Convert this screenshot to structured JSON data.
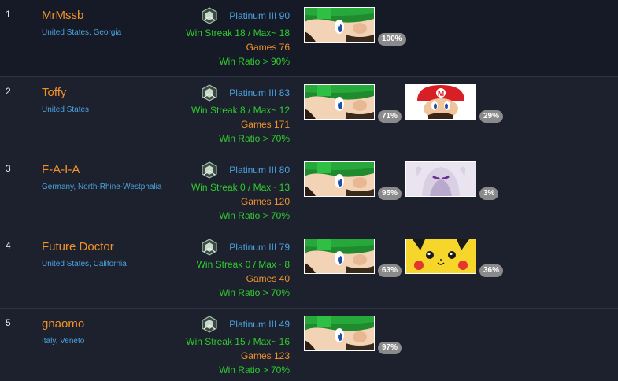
{
  "players": [
    {
      "rank": "1",
      "name": "MrMssb",
      "location": "United States, Georgia",
      "rank_label": "Platinum III 90",
      "win_streak": "Win Streak 18 / Max~ 18",
      "games": "Games 76",
      "win_ratio": "Win Ratio > 90%",
      "characters": [
        {
          "icon": "luigi-icon",
          "percent": "100%"
        }
      ]
    },
    {
      "rank": "2",
      "name": "Toffy",
      "location": "United States",
      "rank_label": "Platinum III 83",
      "win_streak": "Win Streak 8 / Max~ 12",
      "games": "Games 171",
      "win_ratio": "Win Ratio > 70%",
      "characters": [
        {
          "icon": "luigi-icon",
          "percent": "71%"
        },
        {
          "icon": "mario-icon",
          "percent": "29%"
        }
      ]
    },
    {
      "rank": "3",
      "name": "F-A-I-A",
      "location": "Germany, North-Rhine-Westphalia",
      "rank_label": "Platinum III 80",
      "win_streak": "Win Streak 0 / Max~ 13",
      "games": "Games 120",
      "win_ratio": "Win Ratio > 70%",
      "characters": [
        {
          "icon": "luigi-icon",
          "percent": "95%"
        },
        {
          "icon": "mewtwo-icon",
          "percent": "3%"
        }
      ]
    },
    {
      "rank": "4",
      "name": "Future Doctor",
      "location": "United States, California",
      "rank_label": "Platinum III 79",
      "win_streak": "Win Streak 0 / Max~ 8",
      "games": "Games 40",
      "win_ratio": "Win Ratio > 70%",
      "characters": [
        {
          "icon": "luigi-icon",
          "percent": "63%"
        },
        {
          "icon": "pikachu-icon",
          "percent": "36%"
        }
      ]
    },
    {
      "rank": "5",
      "name": "gnaomo",
      "location": "Italy, Veneto",
      "rank_label": "Platinum III 49",
      "win_streak": "Win Streak 15 / Max~ 16",
      "games": "Games 123",
      "win_ratio": "Win Ratio > 70%",
      "characters": [
        {
          "icon": "luigi-icon",
          "percent": "97%"
        }
      ]
    }
  ],
  "colors": {
    "name": "#f0932b",
    "location": "#4aa3df",
    "rank": "#4aa3df",
    "streak": "#2ecc2e",
    "games": "#f0932b",
    "ratio": "#2ecc2e",
    "percent_badge": "#8a8a8a"
  }
}
